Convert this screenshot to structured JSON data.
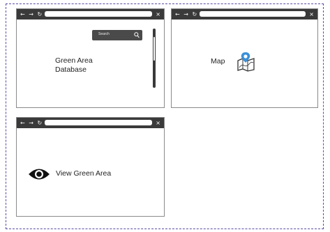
{
  "windows": [
    {
      "search": {
        "placeholder": "Search"
      },
      "content": {
        "line1": "Green Area",
        "line2": "Database"
      },
      "scrollbar": {
        "position": 0.5
      }
    },
    {
      "content": {
        "label": "Map"
      },
      "icon": "map-pin-icon"
    },
    {
      "content": {
        "label": "View Green Area"
      },
      "icon": "eye-icon"
    }
  ],
  "browser": {
    "nav": [
      "←",
      "→",
      "↻"
    ],
    "close": "×"
  },
  "colors": {
    "titlebar": "#3a3a3a",
    "frame": "#5a4aa6",
    "pin": "#3b8fd9"
  }
}
